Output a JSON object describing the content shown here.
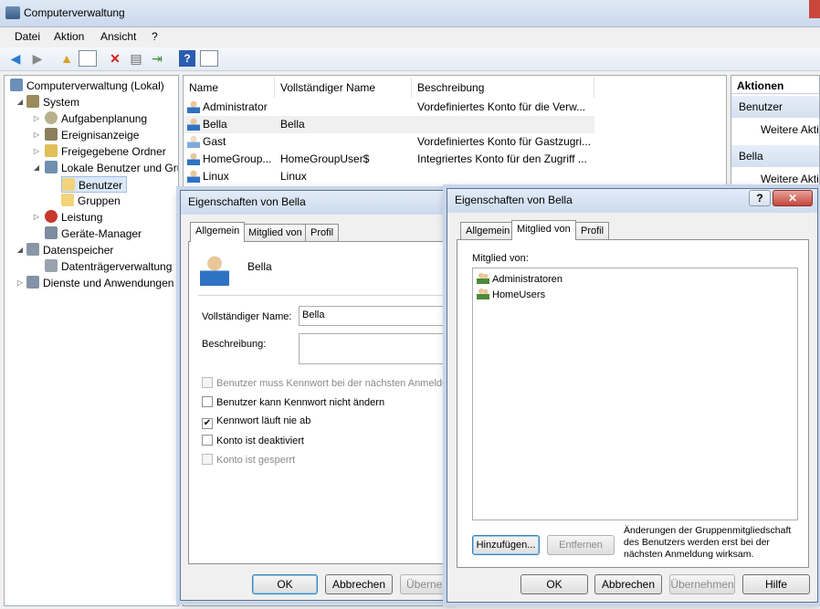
{
  "window": {
    "title": "Computerverwaltung"
  },
  "menu": [
    "Datei",
    "Aktion",
    "Ansicht",
    "?"
  ],
  "tree": [
    {
      "label": "Computerverwaltung (Lokal)"
    },
    {
      "label": "System"
    },
    {
      "label": "Aufgabenplanung"
    },
    {
      "label": "Ereignisanzeige"
    },
    {
      "label": "Freigegebene Ordner"
    },
    {
      "label": "Lokale Benutzer und Gru"
    },
    {
      "label": "Benutzer"
    },
    {
      "label": "Gruppen"
    },
    {
      "label": "Leistung"
    },
    {
      "label": "Geräte-Manager"
    },
    {
      "label": "Datenspeicher"
    },
    {
      "label": "Datenträgerverwaltung"
    },
    {
      "label": "Dienste und Anwendungen"
    }
  ],
  "list": {
    "columns": [
      "Name",
      "Vollständiger Name",
      "Beschreibung"
    ],
    "rows": [
      {
        "name": "Administrator",
        "full": "",
        "desc": "Vordefiniertes Konto für die Verw..."
      },
      {
        "name": "Bella",
        "full": "Bella",
        "desc": ""
      },
      {
        "name": "Gast",
        "full": "",
        "desc": "Vordefiniertes Konto für Gastzugri..."
      },
      {
        "name": "HomeGroup...",
        "full": "HomeGroupUser$",
        "desc": "Integriertes Konto für den Zugriff ..."
      },
      {
        "name": "Linux",
        "full": "Linux",
        "desc": ""
      }
    ]
  },
  "actions": {
    "header": "Aktionen",
    "sections": [
      {
        "title": "Benutzer",
        "item": "Weitere Akti"
      },
      {
        "title": "Bella",
        "item": "Weitere Akti"
      }
    ]
  },
  "dialog1": {
    "title": "Eigenschaften von Bella",
    "tabs": [
      "Allgemein",
      "Mitglied von",
      "Profil"
    ],
    "username": "Bella",
    "fullname_label": "Vollständiger Name:",
    "fullname_value": "Bella",
    "description_label": "Beschreibung:",
    "checkboxes": [
      {
        "label": "Benutzer muss Kennwort bei der nächsten Anmeldung",
        "checked": false,
        "disabled": true
      },
      {
        "label": "Benutzer kann Kennwort nicht ändern",
        "checked": false,
        "disabled": false
      },
      {
        "label": "Kennwort läuft nie ab",
        "checked": true,
        "disabled": false
      },
      {
        "label": "Konto ist deaktiviert",
        "checked": false,
        "disabled": false
      },
      {
        "label": "Konto ist gesperrt",
        "checked": false,
        "disabled": true
      }
    ],
    "buttons": {
      "ok": "OK",
      "cancel": "Abbrechen",
      "apply": "Übernehm"
    }
  },
  "dialog2": {
    "title": "Eigenschaften von Bella",
    "tabs": [
      "Allgemein",
      "Mitglied von",
      "Profil"
    ],
    "member_label": "Mitglied von:",
    "members": [
      "Administratoren",
      "HomeUsers"
    ],
    "add": "Hinzufügen...",
    "remove": "Entfernen",
    "note": [
      "Änderungen der Gruppenmitgliedschaft",
      "des Benutzers werden erst bei der",
      "nächsten Anmeldung wirksam."
    ],
    "buttons": {
      "ok": "OK",
      "cancel": "Abbrechen",
      "apply": "Übernehmen",
      "help": "Hilfe"
    },
    "help_glyph": "?",
    "close_glyph": "✕"
  }
}
